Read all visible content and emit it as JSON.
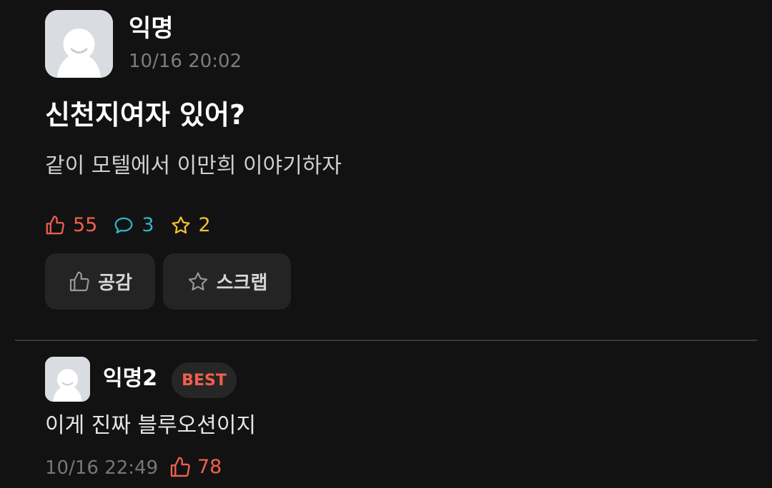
{
  "post": {
    "author": "익명",
    "time": "10/16 20:02",
    "title": "신천지여자 있어?",
    "body": "같이 모텔에서 이만희 이야기하자",
    "stats": {
      "likes": "55",
      "comments": "3",
      "scraps": "2"
    },
    "actions": {
      "like_label": "공감",
      "scrap_label": "스크랩"
    }
  },
  "comment": {
    "author": "익명2",
    "badge": "BEST",
    "text": "이게 진짜 블루오션이지",
    "time": "10/16 22:49",
    "likes": "78"
  },
  "colors": {
    "background": "#121212",
    "like": "#f0604c",
    "comment": "#2fb7c9",
    "scrap": "#f2c230",
    "button_bg": "#242424"
  },
  "icons": [
    "avatar-icon",
    "thumbs-up-icon",
    "speech-bubble-icon",
    "star-icon"
  ]
}
